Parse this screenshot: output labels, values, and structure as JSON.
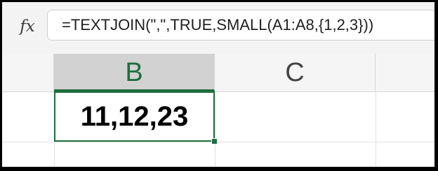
{
  "formula_bar": {
    "fx_label": "fx",
    "formula": "=TEXTJOIN(\",\",TRUE,SMALL(A1:A8,{1,2,3}))"
  },
  "columns": [
    {
      "label": "B",
      "selected": true
    },
    {
      "label": "C",
      "selected": false
    }
  ],
  "active_cell": {
    "value": "11,12,23"
  },
  "colors": {
    "accent_green": "#1e6e3f",
    "formula_bar_bg": "#f3f3f3"
  }
}
